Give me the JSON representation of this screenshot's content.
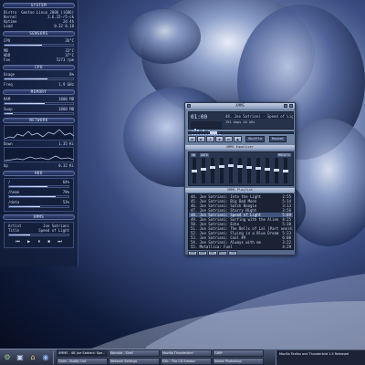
{
  "conky": {
    "system": {
      "header": "SYSTEM",
      "rows": [
        {
          "label": "Distro",
          "value": "Gentoo Linux 2006 (i686)"
        },
        {
          "label": "Kernel",
          "value": "2.6.15-r5-ck"
        },
        {
          "label": "Uptime",
          "value": "2d 4h"
        },
        {
          "label": "Load",
          "value": "0.32 0.18"
        }
      ]
    },
    "sensors": {
      "header": "SENSORS",
      "rows": [
        {
          "label": "CPU",
          "value": "36°C"
        },
        {
          "label": "MB",
          "value": "33°C"
        },
        {
          "label": "HDD",
          "value": "37°C"
        },
        {
          "label": "Fan",
          "value": "5273 rpm"
        }
      ],
      "levels": [
        0.55,
        0.48,
        0.6
      ]
    },
    "cpu": {
      "header": "CPU",
      "rows": [
        {
          "label": "Usage",
          "value": "8%"
        },
        {
          "label": "Freq",
          "value": "1.9 GHz"
        }
      ],
      "level": 0.62
    },
    "memory": {
      "header": "MEMORY",
      "rows": [
        {
          "label": "RAM",
          "value": "1000 MB"
        },
        {
          "label": "Swap",
          "value": "1000 MB"
        }
      ],
      "levels": [
        0.58,
        0.12
      ]
    },
    "network": {
      "header": "NETWORK",
      "rows": [
        {
          "label": "Down",
          "value": "1.35 Ki"
        },
        {
          "label": "Up",
          "value": "0.32 Ki"
        }
      ]
    },
    "hdd": {
      "header": "HDD",
      "rows": [
        {
          "label": "/",
          "value": "64%"
        },
        {
          "label": "/home",
          "value": "79%"
        },
        {
          "label": "/data",
          "value": "53%"
        }
      ],
      "levels": [
        0.64,
        0.79,
        0.53
      ]
    },
    "xmms": {
      "header": "XMMS",
      "artist_label": "Artist",
      "artist": "Joe Satriani",
      "title_label": "Title",
      "title": "Speed of Light",
      "controls": [
        "⏮",
        "▶",
        "⏸",
        "⏹",
        "⏭"
      ],
      "progress": 0.35
    }
  },
  "xmms": {
    "window_title": "XMMS",
    "time": "01:00",
    "song": "48. Joe Satriani - Speed of Light",
    "bitrate": "192 kbps  44 kHz",
    "seek_position": 0.22,
    "buttons": [
      "⏮",
      "▶",
      "⏸",
      "⏹",
      "⏭",
      "⏏"
    ],
    "shuffle_label": "Shuffle",
    "repeat_label": "Repeat",
    "eq_title": "XMMS Equalizer",
    "eq_on": "ON",
    "eq_auto": "AUTO",
    "eq_presets": "PRESETS",
    "eq_levels": [
      0.5,
      0.45,
      0.35,
      0.3,
      0.28,
      0.3,
      0.34,
      0.38,
      0.42,
      0.46,
      0.5
    ],
    "playlist_title": "XMMS Playlist",
    "playlist": [
      {
        "title": "44. Joe Satriani: Into the Light",
        "time": "2:55"
      },
      {
        "title": "45. Joe Satriani: Big Bad Moon",
        "time": "5:14"
      },
      {
        "title": "46. Joe Satriani: Satch Boogie",
        "time": "3:13"
      },
      {
        "title": "47. Joe Satriani: Starry Night",
        "time": "3:56"
      },
      {
        "title": "48. Joe Satriani: Speed of Light",
        "time": "5:09"
      },
      {
        "title": "49. Joe Satriani: Surfing with the Alien",
        "time": "4:25"
      },
      {
        "title": "50. Joe Satriani: Echo",
        "time": "5:38"
      },
      {
        "title": "51. Joe Satriani: The Bells of Lal (Part one)",
        "time": "4:06"
      },
      {
        "title": "52. Joe Satriani: Flying in a Blue Dream",
        "time": "5:23"
      },
      {
        "title": "53. Joe Satriani: Cool #9",
        "time": "6:00"
      },
      {
        "title": "54. Joe Satriani: Always with me",
        "time": "3:22"
      },
      {
        "title": "55. Metallica: Fuel",
        "time": "4:29"
      }
    ],
    "playlist_selected": 4,
    "playlist_buttons": [
      "ADD",
      "REM",
      "SEL",
      "MISC",
      "LIST"
    ]
  },
  "taskbar": {
    "tasks": [
      {
        "label": "XMMS - 48. Joe Satriani: Spe...",
        "active": true
      },
      {
        "label": "Konsole - Shell",
        "active": false
      },
      {
        "label": "Mozilla Thunderbird",
        "active": false
      },
      {
        "label": "GIMP",
        "active": false
      },
      {
        "label": "Gaim - Buddy List",
        "active": false
      },
      {
        "label": "Network Settings",
        "active": false
      },
      {
        "label": "K3b - The CD Kreator",
        "active": false
      },
      {
        "label": "Adobe Photoshop",
        "active": false
      }
    ],
    "tray_text": "Mozilla Firefox and Thunderbird 1.5 Released"
  }
}
